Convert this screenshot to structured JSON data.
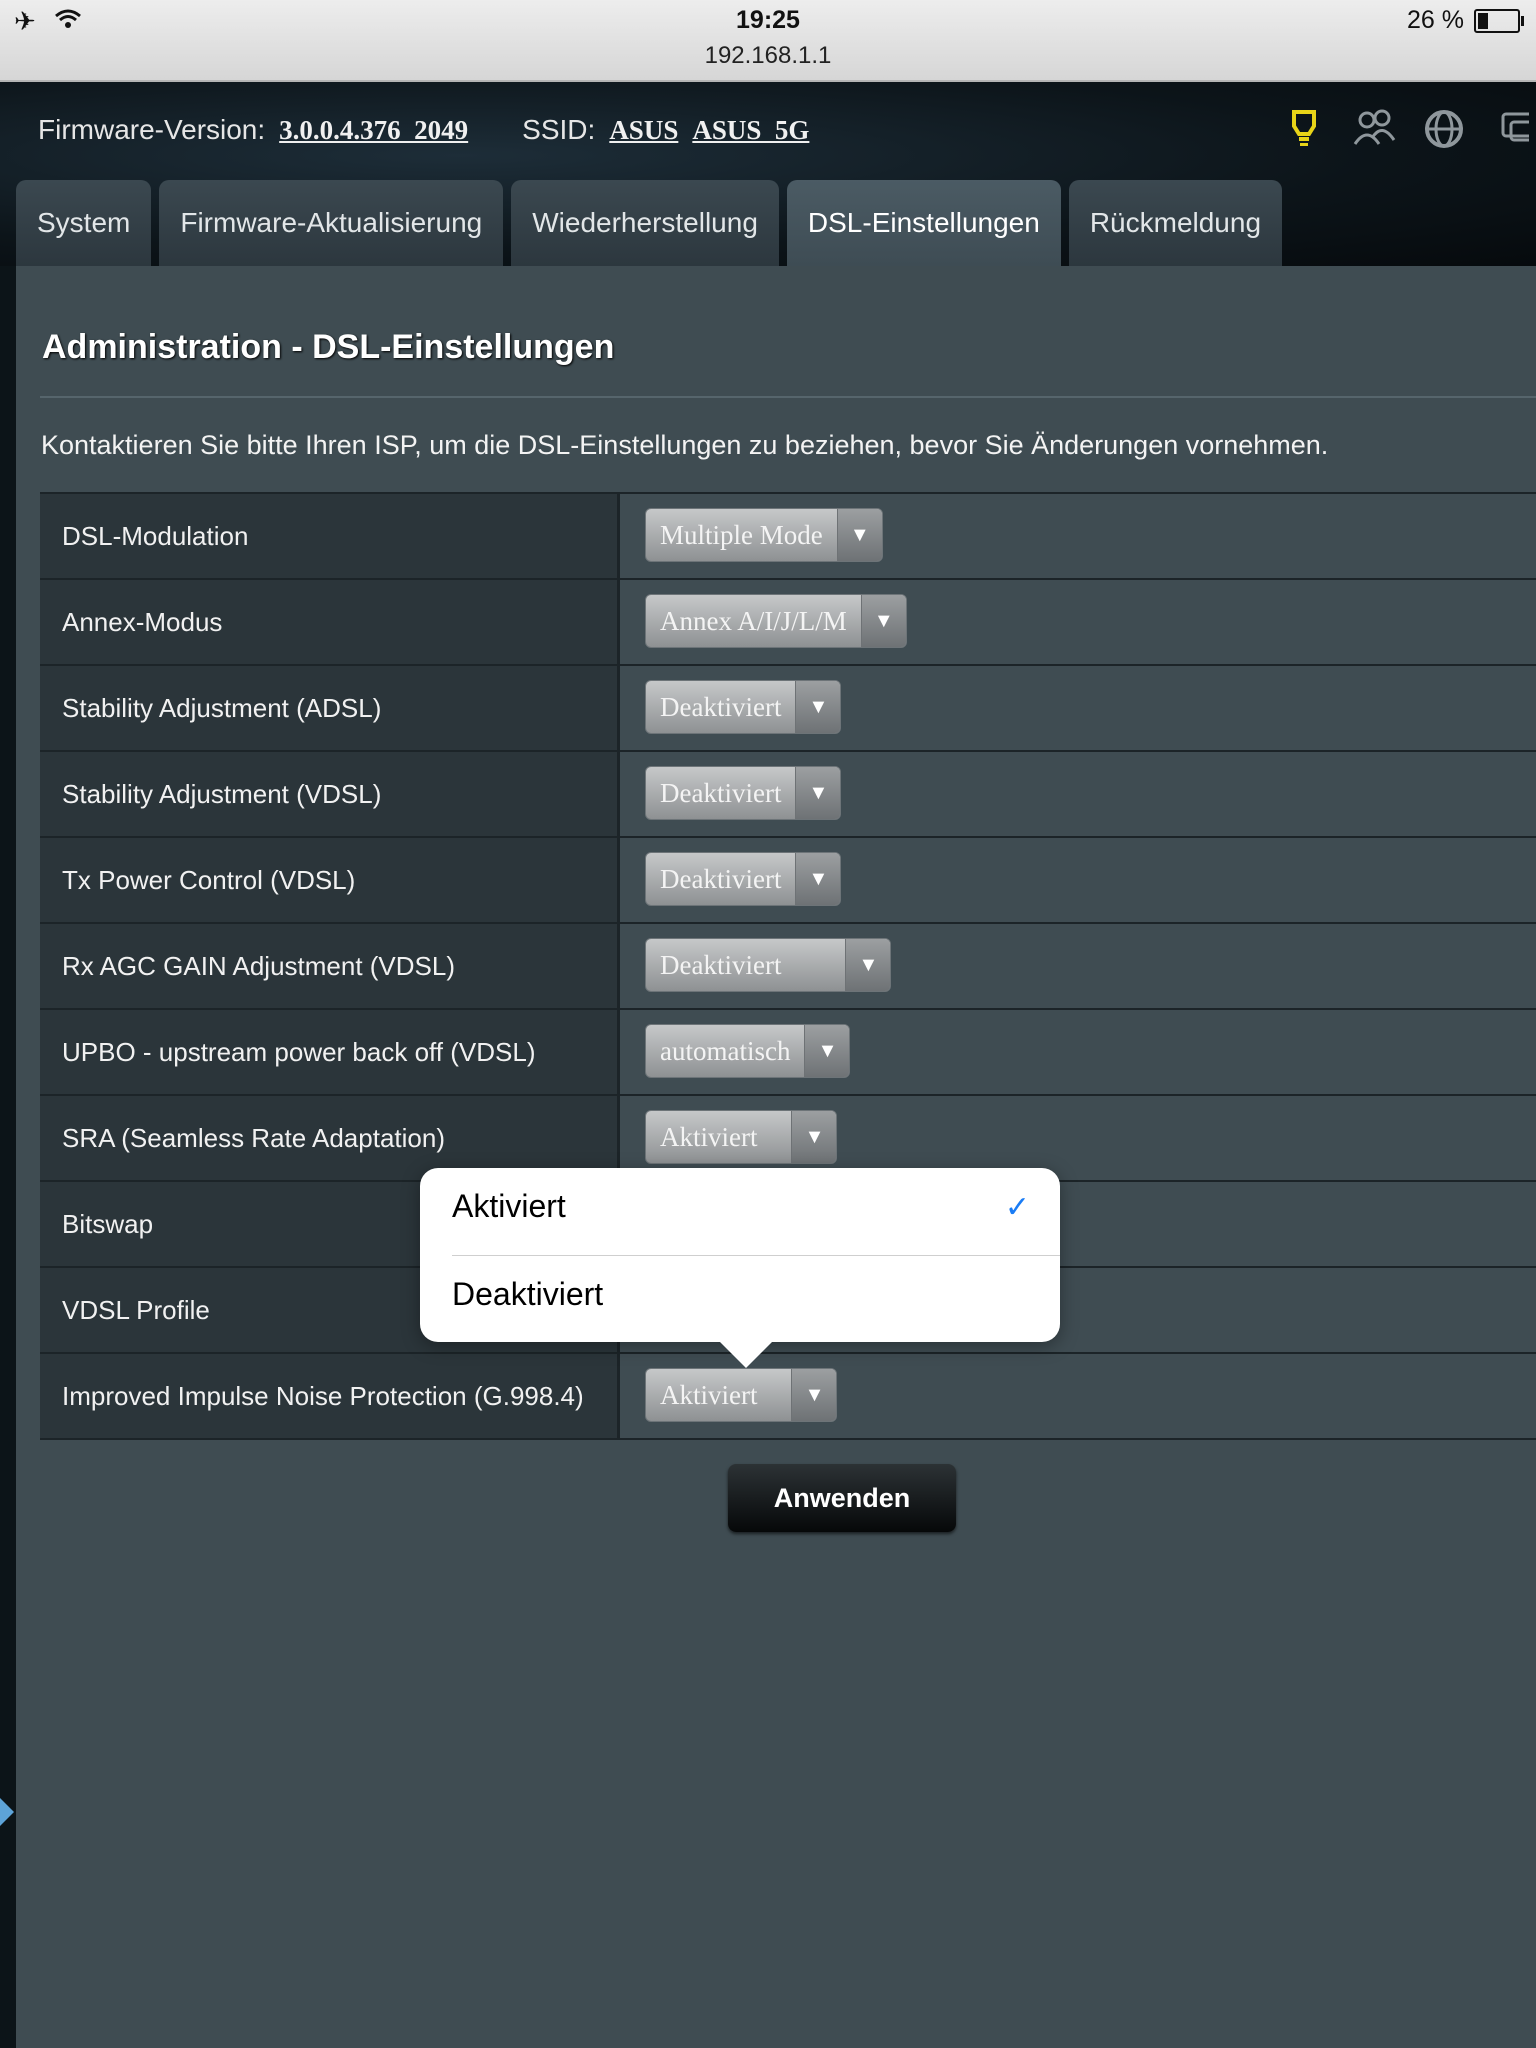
{
  "status_bar": {
    "time": "19:25",
    "url": "192.168.1.1",
    "battery": "26 %",
    "battery_fraction": 0.26,
    "icons": [
      "airplane-icon",
      "wifi-icon",
      "battery-icon"
    ]
  },
  "header": {
    "firmware_label": "Firmware-Version:",
    "firmware_value": "3.0.0.4.376_2049",
    "ssid_label": "SSID:",
    "ssid_1": "ASUS",
    "ssid_2": "ASUS_5G",
    "icons": [
      "bulb-icon",
      "clients-icon",
      "globe-icon",
      "monitor-icon"
    ],
    "accent_color": "#e8d418"
  },
  "tabs": [
    {
      "label": "System",
      "active": false
    },
    {
      "label": "Firmware-Aktualisierung",
      "active": false
    },
    {
      "label": "Wiederherstellung",
      "active": false
    },
    {
      "label": "DSL-Einstellungen",
      "active": true
    },
    {
      "label": "Rückmeldung",
      "active": false
    }
  ],
  "page": {
    "title": "Administration - DSL-Einstellungen",
    "intro": "Kontaktieren Sie bitte Ihren ISP, um die DSL-Einstellungen zu beziehen, bevor Sie Änderungen vornehmen."
  },
  "settings": [
    {
      "label": "DSL-Modulation",
      "value": "Multiple Mode"
    },
    {
      "label": "Annex-Modus",
      "value": "Annex A/I/J/L/M"
    },
    {
      "label": "Stability Adjustment (ADSL)",
      "value": "Deaktiviert"
    },
    {
      "label": "Stability Adjustment (VDSL)",
      "value": "Deaktiviert"
    },
    {
      "label": "Tx Power Control (VDSL)",
      "value": "Deaktiviert"
    },
    {
      "label": "Rx AGC GAIN Adjustment (VDSL)",
      "value": "Deaktiviert"
    },
    {
      "label": "UPBO - upstream power back off (VDSL)",
      "value": "automatisch"
    },
    {
      "label": "SRA (Seamless Rate Adaptation)",
      "value": "Aktiviert"
    },
    {
      "label": "Bitswap",
      "value": ""
    },
    {
      "label": "VDSL Profile",
      "value": ""
    },
    {
      "label": "Improved Impulse Noise Protection (G.998.4)",
      "value": "Aktiviert"
    }
  ],
  "apply_label": "Anwenden",
  "popover": {
    "options": [
      "Aktiviert",
      "Deaktiviert"
    ],
    "selected": "Aktiviert",
    "check_color": "#1a7cf5"
  }
}
